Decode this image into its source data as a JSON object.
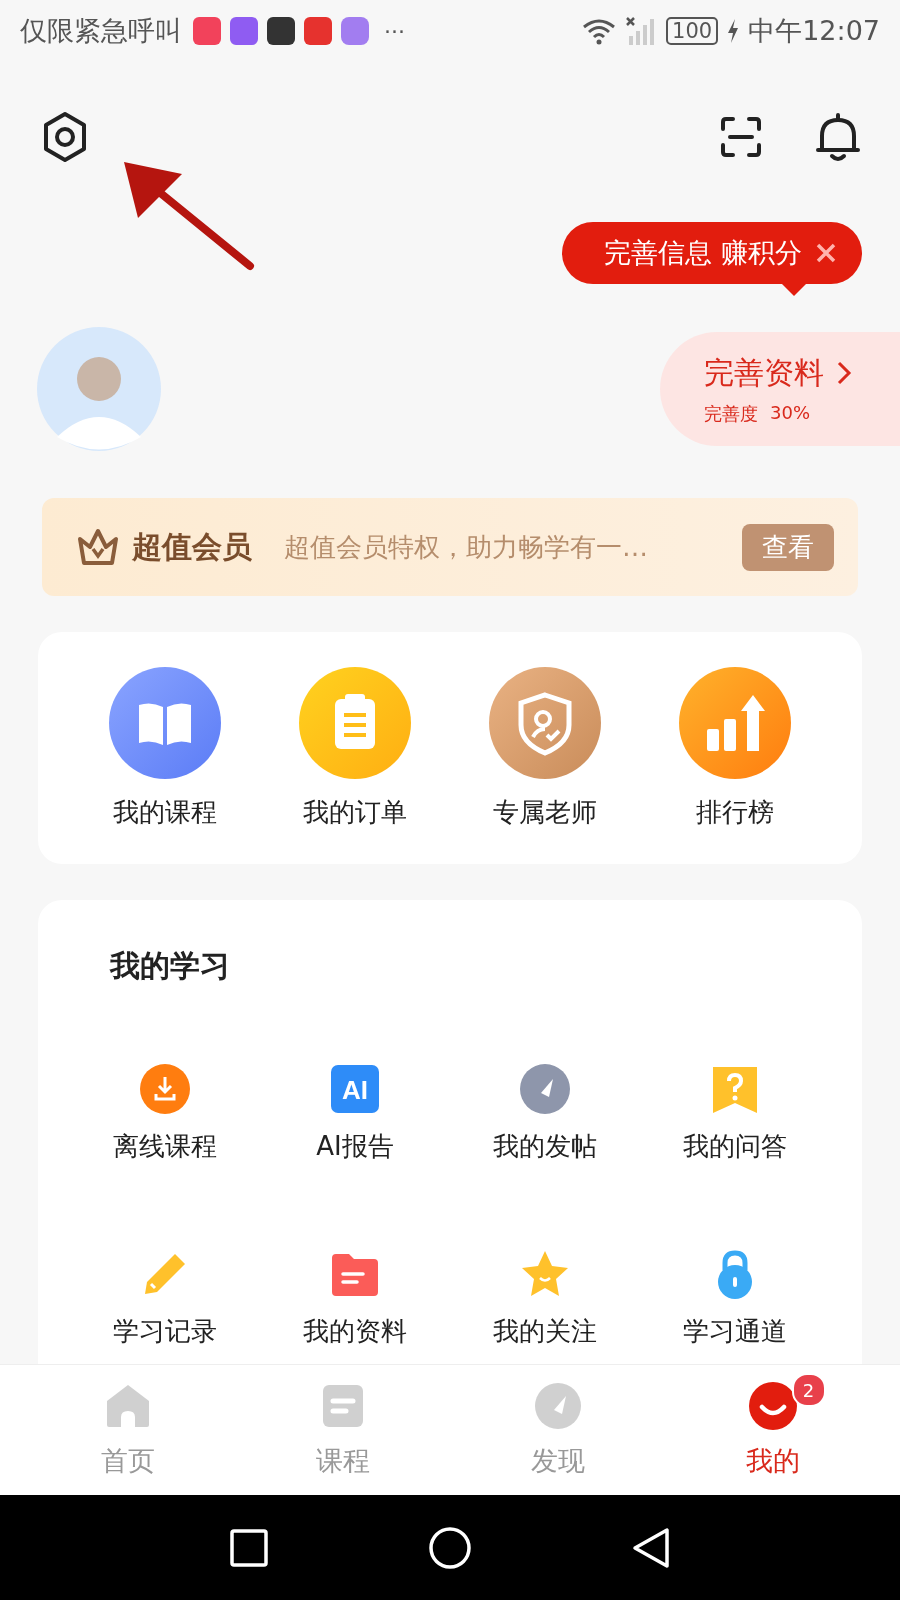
{
  "status_bar": {
    "carrier_text": "仅限紧急呼叫",
    "more": "···",
    "battery": "100",
    "time": "中午12:07"
  },
  "tooltip": {
    "text": "完善信息 赚积分"
  },
  "profile_action": {
    "title": "完善资料",
    "progress_label": "完善度",
    "progress_value": "30%"
  },
  "vip": {
    "title": "超值会员",
    "description": "超值会员特权，助力畅学有一…",
    "button": "查看"
  },
  "shortcuts": [
    {
      "label": "我的课程",
      "kind": "book"
    },
    {
      "label": "我的订单",
      "kind": "clipboard"
    },
    {
      "label": "专属老师",
      "kind": "shield"
    },
    {
      "label": "排行榜",
      "kind": "chart"
    }
  ],
  "study": {
    "title": "我的学习",
    "items": [
      {
        "label": "离线课程",
        "kind": "download"
      },
      {
        "label": "AI报告",
        "kind": "ai",
        "badge_text": "AI"
      },
      {
        "label": "我的发帖",
        "kind": "compass"
      },
      {
        "label": "我的问答",
        "kind": "question"
      },
      {
        "label": "学习记录",
        "kind": "pencil"
      },
      {
        "label": "我的资料",
        "kind": "folder"
      },
      {
        "label": "我的关注",
        "kind": "star"
      },
      {
        "label": "学习通道",
        "kind": "lock"
      }
    ]
  },
  "tab_bar": [
    {
      "label": "首页",
      "kind": "home",
      "selected": false
    },
    {
      "label": "课程",
      "kind": "doc",
      "selected": false
    },
    {
      "label": "发现",
      "kind": "compass",
      "selected": false
    },
    {
      "label": "我的",
      "kind": "me",
      "selected": true,
      "badge": "2"
    }
  ]
}
